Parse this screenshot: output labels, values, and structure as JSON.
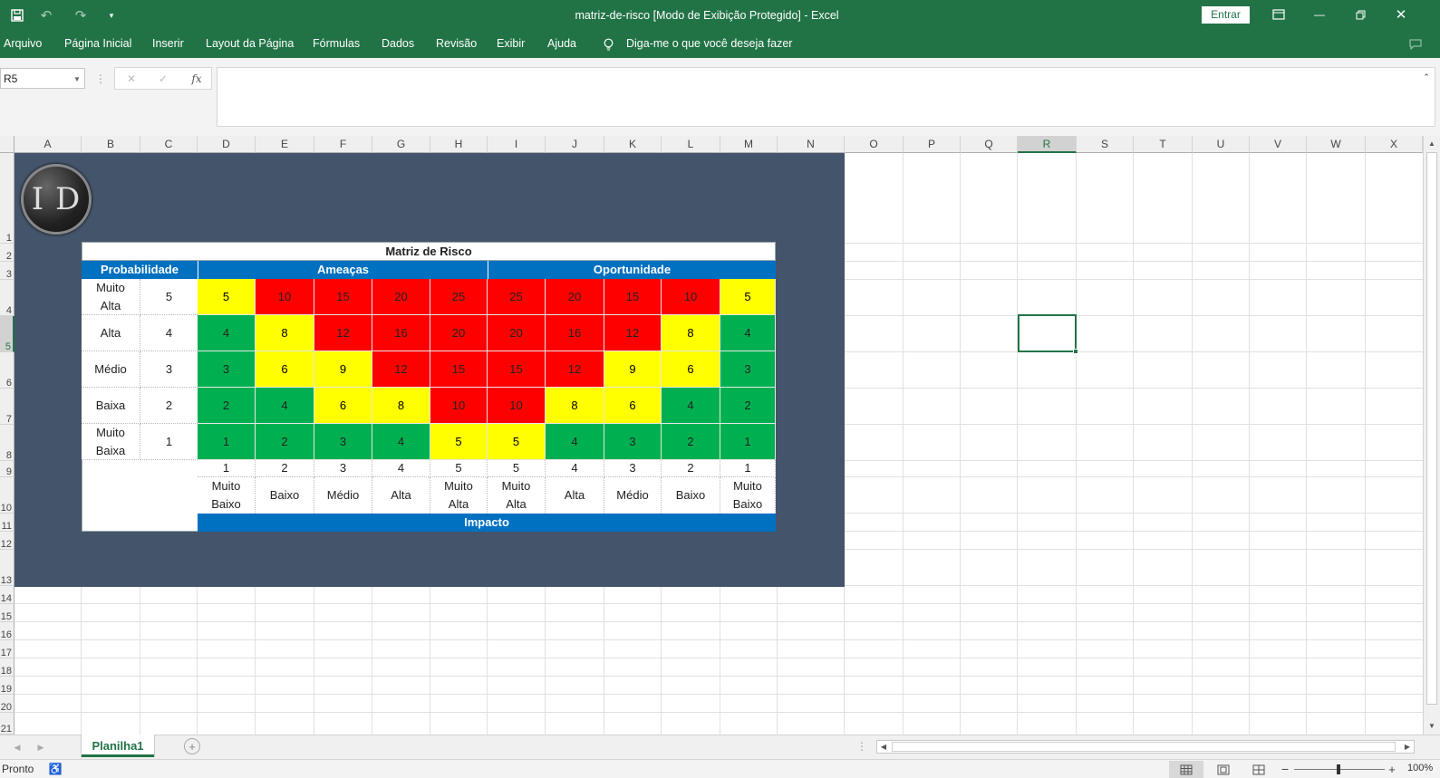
{
  "window": {
    "title": "matriz-de-risco  [Modo de Exibição Protegido]  -  Excel",
    "signin": "Entrar"
  },
  "ribbon": {
    "tabs": [
      "Arquivo",
      "Página Inicial",
      "Inserir",
      "Layout da Página",
      "Fórmulas",
      "Dados",
      "Revisão",
      "Exibir",
      "Ajuda"
    ],
    "tell_me": "Diga-me o que você deseja fazer"
  },
  "formula_bar": {
    "name_box": "R5",
    "fx": "fx",
    "value": ""
  },
  "columns": [
    "A",
    "B",
    "C",
    "D",
    "E",
    "F",
    "G",
    "H",
    "I",
    "J",
    "K",
    "L",
    "M",
    "N",
    "O",
    "P",
    "Q",
    "R",
    "S",
    "T",
    "U",
    "V",
    "W",
    "X"
  ],
  "rows": [
    "1",
    "2",
    "3",
    "4",
    "5",
    "6",
    "7",
    "8",
    "9",
    "10",
    "11",
    "12",
    "13",
    "14",
    "15",
    "16",
    "17",
    "18",
    "19",
    "20",
    "21"
  ],
  "selected_cell": "R5",
  "logo": {
    "text": "I D"
  },
  "matrix": {
    "title": "Matriz de Risco",
    "probability_header": "Probabilidade",
    "threats_header": "Ameaças",
    "opportunities_header": "Oportunidade",
    "impact_header": "Impacto",
    "rows": [
      {
        "label": "Muito Alta",
        "level": "5",
        "values": [
          "5",
          "10",
          "15",
          "20",
          "25",
          "25",
          "20",
          "15",
          "10",
          "5"
        ],
        "colors": [
          "yellow",
          "red",
          "red",
          "red",
          "red",
          "red",
          "red",
          "red",
          "red",
          "yellow"
        ]
      },
      {
        "label": "Alta",
        "level": "4",
        "values": [
          "4",
          "8",
          "12",
          "16",
          "20",
          "20",
          "16",
          "12",
          "8",
          "4"
        ],
        "colors": [
          "green",
          "yellow",
          "red",
          "red",
          "red",
          "red",
          "red",
          "red",
          "yellow",
          "green"
        ]
      },
      {
        "label": "Médio",
        "level": "3",
        "values": [
          "3",
          "6",
          "9",
          "12",
          "15",
          "15",
          "12",
          "9",
          "6",
          "3"
        ],
        "colors": [
          "green",
          "yellow",
          "yellow",
          "red",
          "red",
          "red",
          "red",
          "yellow",
          "yellow",
          "green"
        ]
      },
      {
        "label": "Baixa",
        "level": "2",
        "values": [
          "2",
          "4",
          "6",
          "8",
          "10",
          "10",
          "8",
          "6",
          "4",
          "2"
        ],
        "colors": [
          "green",
          "green",
          "yellow",
          "yellow",
          "red",
          "red",
          "yellow",
          "yellow",
          "green",
          "green"
        ]
      },
      {
        "label": "Muito Baixa",
        "level": "1",
        "values": [
          "1",
          "2",
          "3",
          "4",
          "5",
          "5",
          "4",
          "3",
          "2",
          "1"
        ],
        "colors": [
          "green",
          "green",
          "green",
          "green",
          "yellow",
          "yellow",
          "green",
          "green",
          "green",
          "green"
        ]
      }
    ],
    "impact_levels": [
      "1",
      "2",
      "3",
      "4",
      "5",
      "5",
      "4",
      "3",
      "2",
      "1"
    ],
    "impact_labels": [
      "Muito Baixo",
      "Baixo",
      "Médio",
      "Alta",
      "Muito Alta",
      "Muito Alta",
      "Alta",
      "Médio",
      "Baixo",
      "Muito Baixo"
    ],
    "palette": {
      "red": "#ff0000",
      "yellow": "#ffff00",
      "green": "#00b050",
      "blue": "#0070c0",
      "banner": "#44546a"
    }
  },
  "sheets": {
    "active": "Planilha1"
  },
  "status": {
    "ready": "Pronto",
    "zoom": "100%"
  }
}
